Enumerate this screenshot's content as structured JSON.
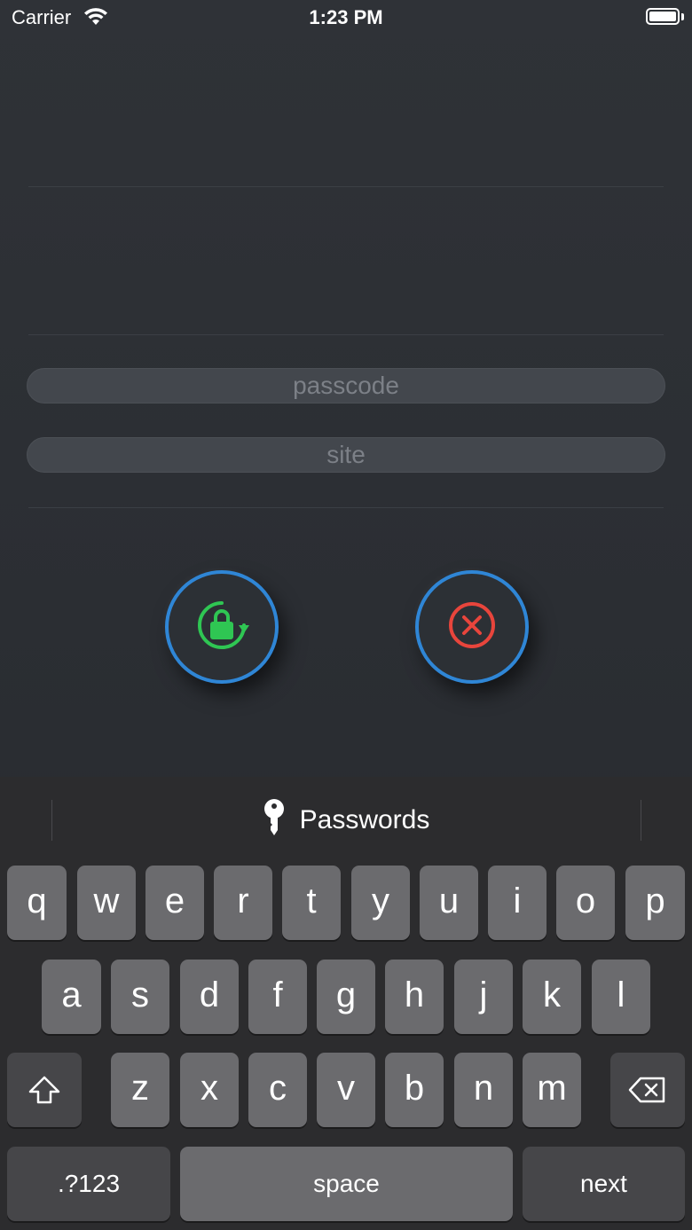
{
  "status_bar": {
    "carrier": "Carrier",
    "time": "1:23 PM"
  },
  "form": {
    "passcode_placeholder": "passcode",
    "site_placeholder": "site"
  },
  "buttons": {
    "generate_icon": "lock-rotate-icon",
    "cancel_icon": "close-circle-icon",
    "accent_color": "#2f86d6",
    "generate_color": "#2fc653",
    "cancel_color": "#e8453c"
  },
  "keyboard": {
    "suggestion": "Passwords",
    "row1": [
      "q",
      "w",
      "e",
      "r",
      "t",
      "y",
      "u",
      "i",
      "o",
      "p"
    ],
    "row2": [
      "a",
      "s",
      "d",
      "f",
      "g",
      "h",
      "j",
      "k",
      "l"
    ],
    "row3": [
      "z",
      "x",
      "c",
      "v",
      "b",
      "n",
      "m"
    ],
    "numbers_label": ".?123",
    "space_label": "space",
    "next_label": "next"
  }
}
